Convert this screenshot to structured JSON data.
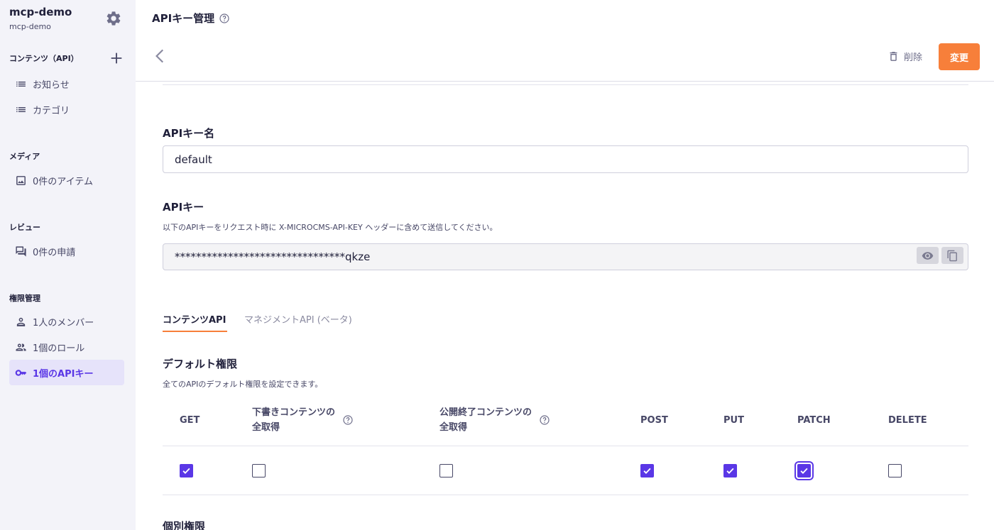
{
  "sidebar": {
    "service_name": "mcp-demo",
    "service_id": "mcp-demo",
    "content_section": "コンテンツ（API）",
    "content_items": [
      {
        "label": "お知らせ",
        "icon": "list-icon"
      },
      {
        "label": "カテゴリ",
        "icon": "list-icon"
      }
    ],
    "media_section": "メディア",
    "media_item": "0件のアイテム",
    "review_section": "レビュー",
    "review_item": "0件の申請",
    "perm_section": "権限管理",
    "perm_items": [
      {
        "label": "1人のメンバー",
        "icon": "person-icon"
      },
      {
        "label": "1個のロール",
        "icon": "people-icon"
      },
      {
        "label": "1個のAPIキー",
        "icon": "key-icon",
        "active": true
      }
    ]
  },
  "header": {
    "title": "APIキー管理",
    "delete_label": "削除",
    "save_label": "変更"
  },
  "form": {
    "name_label": "APIキー名",
    "name_value": "default",
    "key_label": "APIキー",
    "key_desc": "以下のAPIキーをリクエスト時に X-MICROCMS-API-KEY ヘッダーに含めて送信してください。",
    "key_value": "********************************qkze"
  },
  "tabs": [
    {
      "label": "コンテンツAPI",
      "active": true
    },
    {
      "label": "マネジメントAPI (ベータ)",
      "active": false
    }
  ],
  "default_perm": {
    "title": "デフォルト権限",
    "desc": "全てのAPIのデフォルト権限を設定できます。",
    "columns": {
      "get": "GET",
      "draft_line1": "下書きコンテンツの",
      "draft_line2": "全取得",
      "closed_line1": "公開終了コンテンツの",
      "closed_line2": "全取得",
      "post": "POST",
      "put": "PUT",
      "patch": "PATCH",
      "delete": "DELETE"
    },
    "values": {
      "get": true,
      "draft": false,
      "closed": false,
      "post": true,
      "put": true,
      "patch": true,
      "delete": false
    }
  },
  "individual_perm": {
    "title": "個別権限"
  },
  "colors": {
    "accent": "#5a37e6",
    "primary_button": "#f77f3a",
    "sidebar_bg": "#f3f3f9"
  }
}
